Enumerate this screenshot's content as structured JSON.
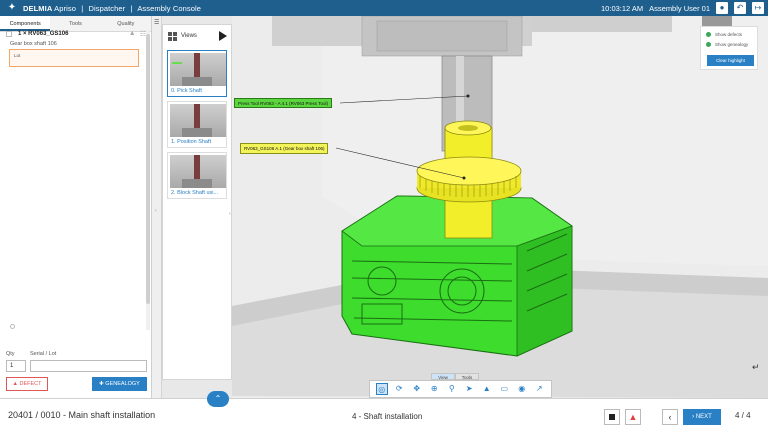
{
  "topbar": {
    "brand": "DELMIA",
    "product": "Apriso",
    "sep1": "|",
    "module": "Dispatcher",
    "sep2": "|",
    "page": "Assembly Console",
    "time": "10:03:12 AM",
    "user": "Assembly User 01",
    "icons": [
      "user-icon",
      "back-icon",
      "logout-icon"
    ]
  },
  "left": {
    "tabs": [
      "Components",
      "Tools",
      "Quality"
    ],
    "component": {
      "title": "1 × RV063_GS106",
      "subtitle": "Gear box shaft 106",
      "lot_label": "Lot"
    },
    "qty_label": "Qty",
    "qty_value": "1",
    "serial_label": "Serial / Lot",
    "serial_value": "",
    "defect_label": "DEFECT",
    "genealogy_label": "GENEALOGY"
  },
  "views": {
    "title": "Views",
    "items": [
      {
        "label": "0. Pick Shaft",
        "active": true
      },
      {
        "label": "1. Position Shaft",
        "active": false
      },
      {
        "label": "2. Block Shaft usi...",
        "active": false
      }
    ]
  },
  "viewport": {
    "tag_press": "Press Tool RV063 - A 4.1 (RV063 Press Tool)",
    "tag_shaft": "RV063_GS106 A.1 (Gear box shaft 106)",
    "show_defects": "Show defects",
    "show_genealogy": "Show genealogy",
    "clear_highlight": "Clear highlight",
    "tabs": [
      "View",
      "Tools"
    ],
    "tools": [
      "fit-all-icon",
      "rotate-icon",
      "pan-icon",
      "zoom-icon",
      "zoom-area-icon",
      "select-icon",
      "render-style-icon",
      "section-icon",
      "visibility-icon",
      "measure-icon"
    ]
  },
  "bottom": {
    "operation": "20401 / 0010 - Main shaft installation",
    "step": "4 - Shaft installation",
    "next_label": "NEXT",
    "pager": "4 / 4"
  },
  "colors": {
    "header": "#1f5f8e",
    "accent": "#2a80c5",
    "part_green": "#3ddc2d",
    "part_yellow": "#f2ee2a",
    "defect": "#e05757"
  }
}
